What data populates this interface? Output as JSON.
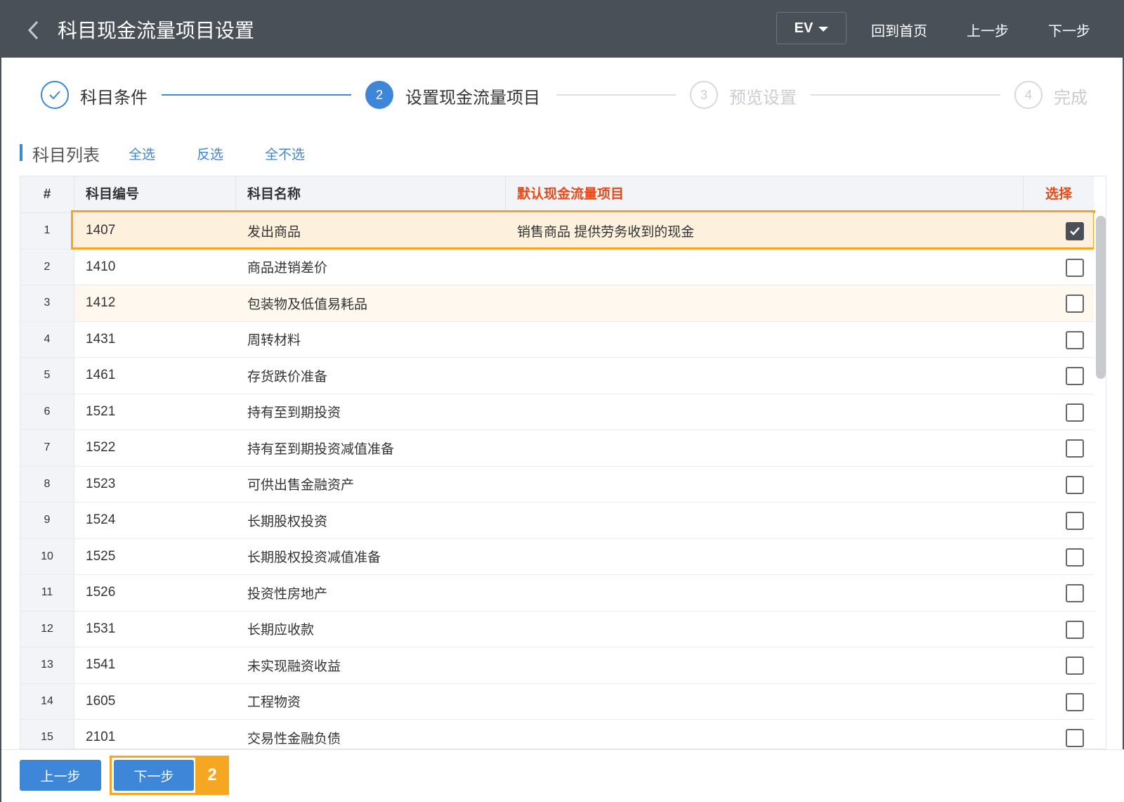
{
  "header": {
    "title": "科目现金流量项目设置",
    "dropdown_value": "EV",
    "home_label": "回到首页",
    "prev_label": "上一步",
    "next_label": "下一步"
  },
  "steps": [
    {
      "number": "",
      "label": "科目条件",
      "state": "done"
    },
    {
      "number": "2",
      "label": "设置现金流量项目",
      "state": "active"
    },
    {
      "number": "3",
      "label": "预览设置",
      "state": "todo"
    },
    {
      "number": "4",
      "label": "完成",
      "state": "todo"
    }
  ],
  "section": {
    "title": "科目列表",
    "select_all": "全选",
    "invert": "反选",
    "select_none": "全不选"
  },
  "table": {
    "headers": {
      "num": "#",
      "code": "科目编号",
      "name": "科目名称",
      "default_item": "默认现金流量项目",
      "select": "选择"
    },
    "rows": [
      {
        "num": "1",
        "code": "1407",
        "name": "发出商品",
        "item": "销售商品 提供劳务收到的现金",
        "checked": true
      },
      {
        "num": "2",
        "code": "1410",
        "name": "商品进销差价",
        "item": "",
        "checked": false
      },
      {
        "num": "3",
        "code": "1412",
        "name": "包装物及低值易耗品",
        "item": "",
        "checked": false
      },
      {
        "num": "4",
        "code": "1431",
        "name": "周转材料",
        "item": "",
        "checked": false
      },
      {
        "num": "5",
        "code": "1461",
        "name": "存货跌价准备",
        "item": "",
        "checked": false
      },
      {
        "num": "6",
        "code": "1521",
        "name": "持有至到期投资",
        "item": "",
        "checked": false
      },
      {
        "num": "7",
        "code": "1522",
        "name": "持有至到期投资减值准备",
        "item": "",
        "checked": false
      },
      {
        "num": "8",
        "code": "1523",
        "name": "可供出售金融资产",
        "item": "",
        "checked": false
      },
      {
        "num": "9",
        "code": "1524",
        "name": "长期股权投资",
        "item": "",
        "checked": false
      },
      {
        "num": "10",
        "code": "1525",
        "name": "长期股权投资减值准备",
        "item": "",
        "checked": false
      },
      {
        "num": "11",
        "code": "1526",
        "name": "投资性房地产",
        "item": "",
        "checked": false
      },
      {
        "num": "12",
        "code": "1531",
        "name": "长期应收款",
        "item": "",
        "checked": false
      },
      {
        "num": "13",
        "code": "1541",
        "name": "未实现融资收益",
        "item": "",
        "checked": false
      },
      {
        "num": "14",
        "code": "1605",
        "name": "工程物资",
        "item": "",
        "checked": false
      },
      {
        "num": "15",
        "code": "2101",
        "name": "交易性金融负债",
        "item": "",
        "checked": false
      }
    ]
  },
  "footer": {
    "prev_label": "上一步",
    "next_label": "下一步",
    "badge": "2"
  },
  "colors": {
    "header_bg": "#4a5058",
    "accent": "#3d86d8",
    "highlight": "#f5a623",
    "red_header": "#e64a19"
  }
}
